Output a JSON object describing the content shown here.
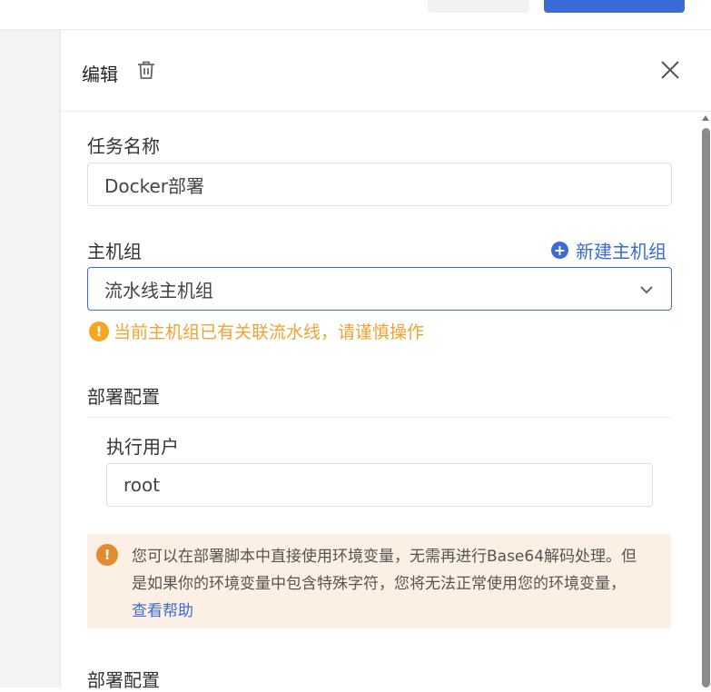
{
  "drawer": {
    "title": "编辑",
    "task_name": {
      "label": "任务名称",
      "value": "Docker部署"
    },
    "host_group": {
      "label": "主机组",
      "new_link": "新建主机组",
      "selected": "流水线主机组",
      "warning": "当前主机组已有关联流水线，请谨慎操作"
    },
    "deploy_config": {
      "section_title": "部署配置",
      "exec_user": {
        "label": "执行用户",
        "value": "root"
      },
      "alert_text": "您可以在部署脚本中直接使用环境变量，无需再进行Base64解码处理。但是如果你的环境变量中包含特殊字符，您将无法正常使用您的环境变量，",
      "alert_link": "查看帮助"
    },
    "deploy_config_2": {
      "section_title": "部署配置"
    }
  },
  "icons": {
    "delete": "trash-icon",
    "close": "close-icon",
    "dropdown": "chevron-down-icon",
    "add": "plus-circle-icon",
    "warning": "exclamation-circle-icon"
  },
  "colors": {
    "primary": "#3a6bd8",
    "warning_text": "#f0a233",
    "alert_bg": "#fcefe4"
  }
}
